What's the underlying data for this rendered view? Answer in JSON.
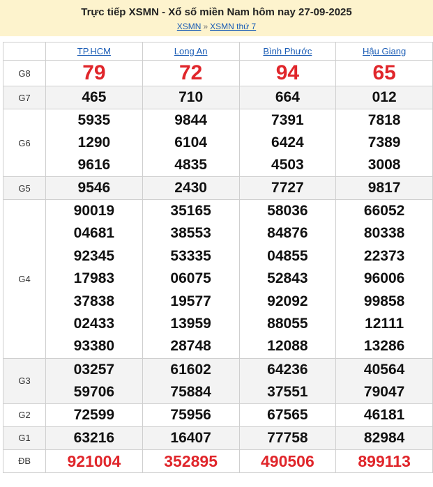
{
  "header": {
    "title": "Trực tiếp XSMN - Xổ số miền Nam hôm nay 27-09-2025",
    "breadcrumbs": [
      "XSMN",
      "XSMN thứ 7"
    ],
    "separator": "»"
  },
  "provinces": [
    "TP.HCM",
    "Long An",
    "Bình Phước",
    "Hậu Giang"
  ],
  "prizes": [
    {
      "label": "G8",
      "values": [
        [
          "79"
        ],
        [
          "72"
        ],
        [
          "94"
        ],
        [
          "65"
        ]
      ]
    },
    {
      "label": "G7",
      "values": [
        [
          "465"
        ],
        [
          "710"
        ],
        [
          "664"
        ],
        [
          "012"
        ]
      ]
    },
    {
      "label": "G6",
      "values": [
        [
          "5935",
          "1290",
          "9616"
        ],
        [
          "9844",
          "6104",
          "4835"
        ],
        [
          "7391",
          "6424",
          "4503"
        ],
        [
          "7818",
          "7389",
          "3008"
        ]
      ]
    },
    {
      "label": "G5",
      "values": [
        [
          "9546"
        ],
        [
          "2430"
        ],
        [
          "7727"
        ],
        [
          "9817"
        ]
      ]
    },
    {
      "label": "G4",
      "values": [
        [
          "90019",
          "04681",
          "92345",
          "17983",
          "37838",
          "02433",
          "93380"
        ],
        [
          "35165",
          "38553",
          "53335",
          "06075",
          "19577",
          "13959",
          "28748"
        ],
        [
          "58036",
          "84876",
          "04855",
          "52843",
          "92092",
          "88055",
          "12088"
        ],
        [
          "66052",
          "80338",
          "22373",
          "96006",
          "99858",
          "12111",
          "13286"
        ]
      ]
    },
    {
      "label": "G3",
      "values": [
        [
          "03257",
          "59706"
        ],
        [
          "61602",
          "75884"
        ],
        [
          "64236",
          "37551"
        ],
        [
          "40564",
          "79047"
        ]
      ]
    },
    {
      "label": "G2",
      "values": [
        [
          "72599"
        ],
        [
          "75956"
        ],
        [
          "67565"
        ],
        [
          "46181"
        ]
      ]
    },
    {
      "label": "G1",
      "values": [
        [
          "63216"
        ],
        [
          "16407"
        ],
        [
          "77758"
        ],
        [
          "82984"
        ]
      ]
    },
    {
      "label": "ĐB",
      "values": [
        [
          "921004"
        ],
        [
          "352895"
        ],
        [
          "490506"
        ],
        [
          "899113"
        ]
      ]
    }
  ],
  "colors": {
    "header_bg": "#fdf3cd",
    "link": "#1a5cb5",
    "highlight": "#e0262b",
    "alt_row": "#f3f3f3"
  }
}
